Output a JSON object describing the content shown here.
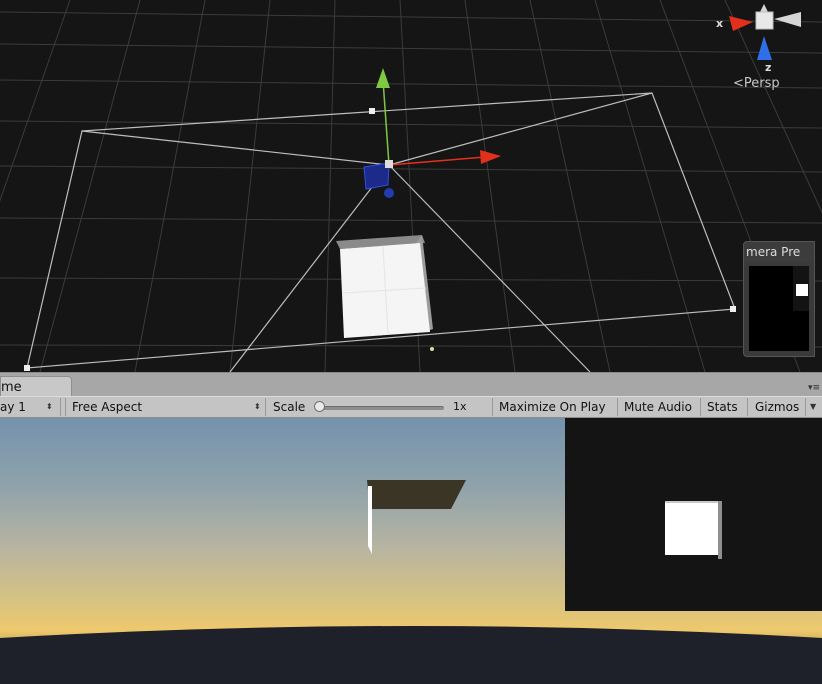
{
  "scene": {
    "gizmo": {
      "x_axis_label": "x",
      "z_axis_label": "z",
      "projection_label": "Persp"
    },
    "camera_preview": {
      "title": "mera Pre"
    },
    "colors": {
      "x_axis": "#e3301c",
      "y_axis": "#7ec93f",
      "z_axis": "#2f6fe8",
      "grid": "#3a3a3a",
      "background": "#151515"
    }
  },
  "game": {
    "tab_label": "me",
    "toolbar": {
      "display": "ay 1",
      "aspect": "Free Aspect",
      "scale_label": "Scale",
      "scale_value": "1x",
      "scale_fraction": 0,
      "maximize_on_play": "Maximize On Play",
      "mute_audio": "Mute Audio",
      "stats": "Stats",
      "gizmos": "Gizmos"
    }
  }
}
